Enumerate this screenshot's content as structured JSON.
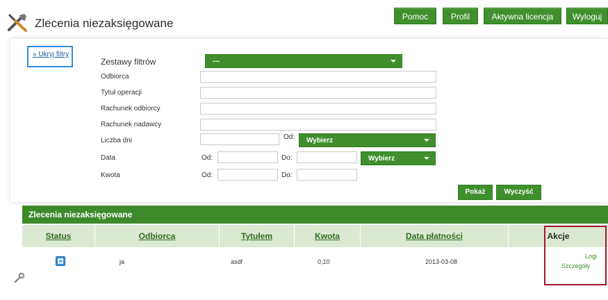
{
  "header": {
    "title": "Zlecenia niezaksięgowane",
    "nav": [
      "Pomoc",
      "Profil",
      "Aktywna licencja",
      "Wyloguj"
    ]
  },
  "filters": {
    "toggle_label": "» Ukryj filtry",
    "sets_label": "Zestawy filtrów",
    "sets_value": "---",
    "recipient_label": "Odbiorca",
    "title_label": "Tytuł operacji",
    "recipient_account_label": "Rachunek odbiorcy",
    "sender_account_label": "Rachunek nadawcy",
    "days_label": "Liczba dni",
    "days_from_label": "Od:",
    "days_select_value": "Wybierz",
    "date_label": "Data",
    "date_from_label": "Od:",
    "date_to_label": "Do:",
    "date_select_value": "Wybierz",
    "amount_label": "Kwota",
    "amount_from_label": "Od:",
    "amount_to_label": "Do:",
    "show_button": "Pokaż",
    "clear_button": "Wyczyść"
  },
  "table": {
    "title": "Zlecenia niezaksięgowane",
    "columns": [
      "Status",
      "Odbiorca",
      "Tytułem",
      "Kwota",
      "Data płatności",
      "Akcje"
    ],
    "rows": [
      {
        "recipient": "ja",
        "title": "asdf",
        "amount": "0,10",
        "date": "2013-03-08",
        "actions": [
          "Logi",
          "Szczegóły"
        ]
      }
    ]
  },
  "colors": {
    "accent_green": "#3f8f2c",
    "header_green": "#3d8a2a",
    "column_bg": "#dbe9d2",
    "highlight_red": "#a3162a",
    "focus_blue": "#2f8ee2"
  },
  "icons": [
    "tools-icon",
    "status-icon",
    "wrench-icon"
  ]
}
